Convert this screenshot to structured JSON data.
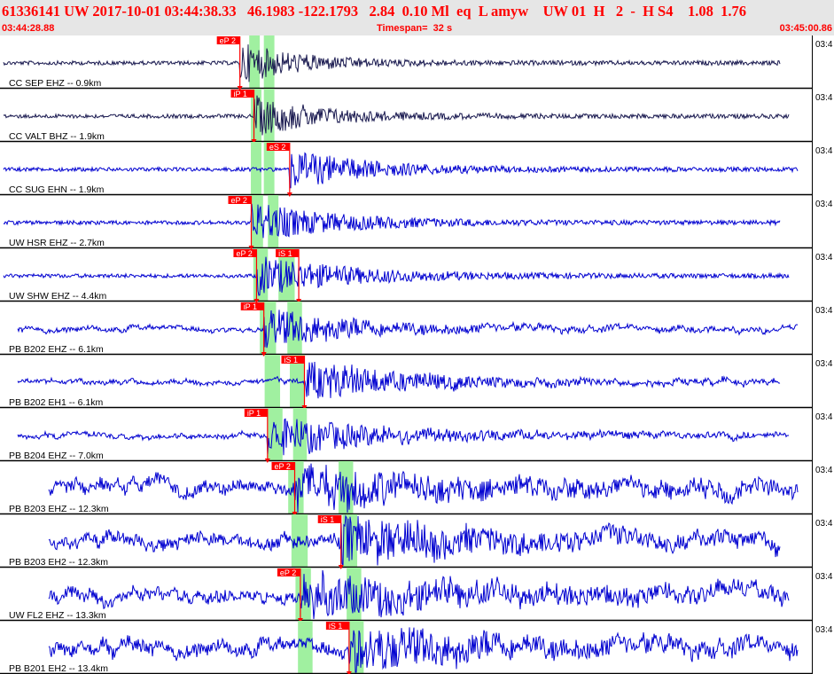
{
  "header": {
    "info": "61336141 UW 2017-10-01 03:44:38.33   46.1983 -122.1793   2.84  0.10 Ml  eq  L amyw    UW 01  H   2  -  H S4    1.08  1.76",
    "start_time": "03:44:28.88",
    "timespan": "Timespan=  32 s",
    "end_time": "03:45:00.86"
  },
  "colors": {
    "header_bg": "#e6e6e6",
    "header_text": "#ff0000",
    "trace_blue": "#0000d0",
    "trace_dark": "#1a1a50",
    "pick_red": "#ff0000",
    "window_green": "#a0f0a0"
  },
  "right_time_label": "03:4",
  "traces": [
    {
      "label": "CC SEP EHZ -- 0.9km",
      "color": "dark",
      "picks": [
        {
          "text": "eP 2",
          "t": 0.2955
        }
      ],
      "windows": [
        [
          0.307,
          0.32
        ],
        [
          0.325,
          0.338
        ]
      ]
    },
    {
      "label": "CC VALT BHZ -- 1.9km",
      "color": "dark",
      "picks": [
        {
          "text": "iP 1",
          "t": 0.3128
        }
      ],
      "windows": [
        [
          0.309,
          0.322
        ],
        [
          0.325,
          0.338
        ]
      ]
    },
    {
      "label": "CC SUG EHN -- 1.9km",
      "color": "blue",
      "picks": [
        {
          "text": "eS 2",
          "t": 0.3568
        }
      ],
      "windows": [
        [
          0.309,
          0.322
        ],
        [
          0.325,
          0.338
        ]
      ]
    },
    {
      "label": "UW HSR EHZ -- 2.7km",
      "color": "blue",
      "picks": [
        {
          "text": "eP 2",
          "t": 0.3095
        }
      ],
      "windows": [
        [
          0.309,
          0.324
        ],
        [
          0.33,
          0.343
        ]
      ]
    },
    {
      "label": "UW SHW EHZ -- 4.4km",
      "color": "blue",
      "picks": [
        {
          "text": "eP 2",
          "t": 0.316
        },
        {
          "text": "iS 1",
          "t": 0.368
        }
      ],
      "windows": [
        [
          0.312,
          0.33
        ],
        [
          0.343,
          0.363
        ]
      ]
    },
    {
      "label": "PB B202 EHZ -- 6.1km",
      "color": "blue",
      "picks": [
        {
          "text": "iP 1",
          "t": 0.325
        }
      ],
      "windows": [
        [
          0.32,
          0.34
        ],
        [
          0.354,
          0.372
        ]
      ]
    },
    {
      "label": "PB B202 EH1 -- 6.1km",
      "color": "blue",
      "picks": [
        {
          "text": "iS 1",
          "t": 0.375
        }
      ],
      "windows": [
        [
          0.326,
          0.345
        ],
        [
          0.357,
          0.375
        ]
      ]
    },
    {
      "label": "PB B204 EHZ -- 7.0km",
      "color": "blue",
      "picks": [
        {
          "text": "iP 1",
          "t": 0.3295
        }
      ],
      "windows": [
        [
          0.33,
          0.348
        ],
        [
          0.361,
          0.378
        ]
      ]
    },
    {
      "label": "PB B203 EHZ -- 12.3km",
      "color": "blue",
      "picks": [
        {
          "text": "eP 2",
          "t": 0.363
        }
      ],
      "windows": [
        [
          0.355,
          0.374
        ],
        [
          0.417,
          0.435
        ]
      ]
    },
    {
      "label": "PB B203 EH2 -- 12.3km",
      "color": "blue",
      "picks": [
        {
          "text": "iS 1",
          "t": 0.42
        }
      ],
      "windows": [
        [
          0.359,
          0.379
        ],
        [
          0.422,
          0.44
        ]
      ]
    },
    {
      "label": "UW FL2 EHZ -- 13.3km",
      "color": "blue",
      "picks": [
        {
          "text": "eP 2",
          "t": 0.37
        }
      ],
      "windows": [
        [
          0.364,
          0.383
        ],
        [
          0.427,
          0.445
        ]
      ]
    },
    {
      "label": "PB B201 EH2 -- 13.4km",
      "color": "blue",
      "picks": [
        {
          "text": "iS 1",
          "t": 0.43
        }
      ],
      "windows": [
        [
          0.367,
          0.385
        ],
        [
          0.43,
          0.448
        ]
      ]
    }
  ]
}
